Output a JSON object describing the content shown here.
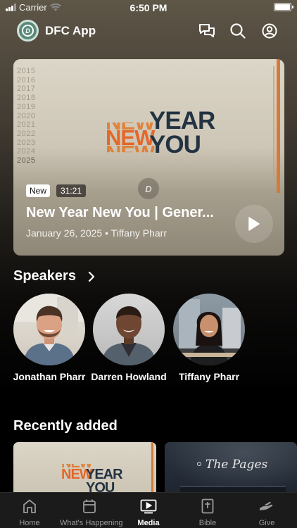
{
  "status_bar": {
    "carrier": "Carrier",
    "time": "6:50 PM"
  },
  "header": {
    "app_name": "DFC App",
    "logo_letter": "D",
    "icons": [
      "chat-bubbles-icon",
      "search-icon",
      "account-icon"
    ]
  },
  "hero": {
    "artwork_years": [
      "2015",
      "2016",
      "2017",
      "2018",
      "2019",
      "2020",
      "2021",
      "2022",
      "2023",
      "2024",
      "2025"
    ],
    "artwork_new": "NEW",
    "artwork_year": "YEAR",
    "artwork_you": "YOU",
    "badge": "New",
    "duration": "31:21",
    "title": "New Year New You | Gener...",
    "date": "January 26, 2025",
    "separator": "•",
    "speaker": "Tiffany Pharr"
  },
  "speakers": {
    "title": "Speakers",
    "items": [
      {
        "name": "Jonathan Pharr"
      },
      {
        "name": "Darren Howland"
      },
      {
        "name": "Tiffany Pharr"
      }
    ]
  },
  "recent": {
    "title": "Recently added",
    "items": [
      {
        "art_new": "NEW",
        "art_year": "YEAR",
        "art_you": "YOU"
      },
      {
        "art_title": "The Pages"
      }
    ]
  },
  "tabs": [
    {
      "label": "Home",
      "icon": "home-icon",
      "active": false
    },
    {
      "label": "What's Happening",
      "icon": "calendar-icon",
      "active": false
    },
    {
      "label": "Media",
      "icon": "media-play-icon",
      "active": true
    },
    {
      "label": "Bible",
      "icon": "bible-icon",
      "active": false
    },
    {
      "label": "Give",
      "icon": "give-hand-icon",
      "active": false
    }
  ],
  "colors": {
    "accent_orange": "#e4672a",
    "artwork_navy": "#233343",
    "tab_bar": "#1b1b1b"
  }
}
